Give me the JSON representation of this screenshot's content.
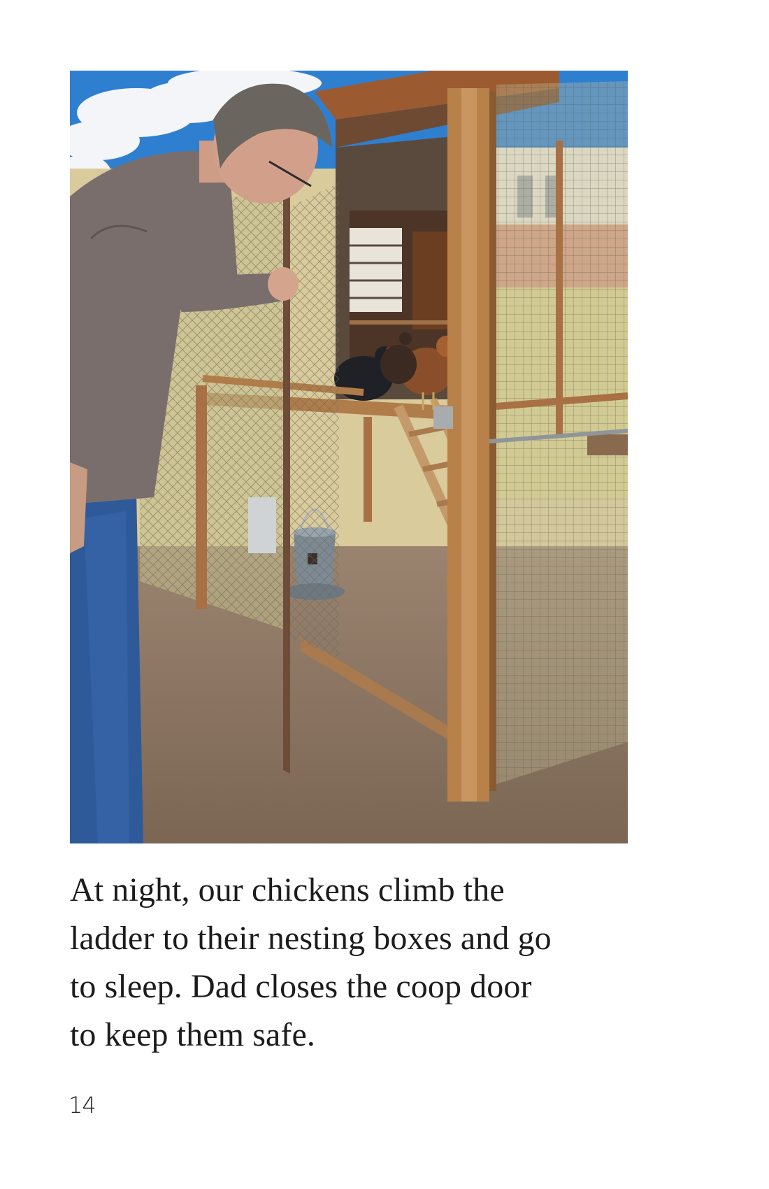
{
  "page": {
    "body_lines": [
      "At night, our chickens climb the",
      "ladder to their nesting boxes and go",
      "to sleep. Dad closes the coop door",
      "to keep them safe."
    ],
    "page_number": "14"
  },
  "colors": {
    "sky": "#2f7fd1",
    "dirt": "#8b7561",
    "wood": "#b07c49",
    "shirt": "#7a6e6c",
    "jeans": "#2f5a9a"
  }
}
